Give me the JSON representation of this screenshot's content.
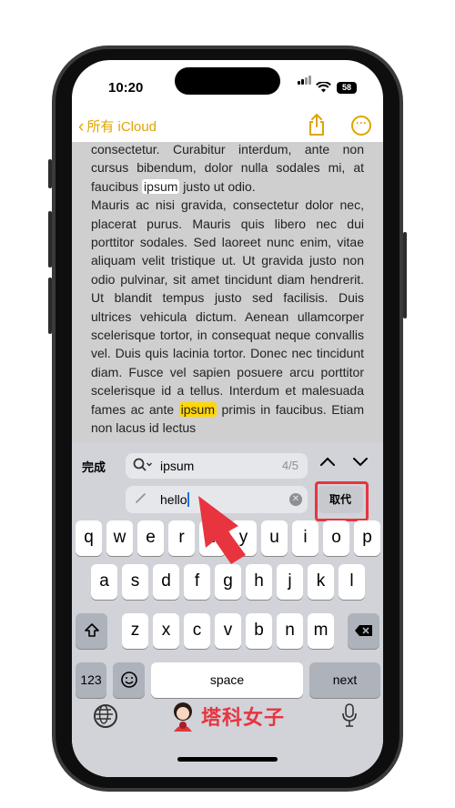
{
  "status_bar": {
    "time": "10:20",
    "battery": "58"
  },
  "nav": {
    "back_label": "所有 iCloud"
  },
  "note": {
    "t1": "consectetur. Curabitur interdum, ante non cursus bibendum, dolor nulla sodales mi, at faucibus ",
    "m1": "ipsum",
    "t2": " justo ut odio.",
    "t3": "Mauris ac nisi gravida, consectetur dolor nec, placerat purus. Mauris quis libero nec dui porttitor sodales. Sed laoreet nunc enim, vitae aliquam velit tristique ut. Ut gravida justo non odio pulvinar, sit amet tincidunt diam hendrerit. Ut blandit tempus justo sed facilisis. Duis ultrices vehicula dictum. Aenean ullamcorper scelerisque tortor, in consequat neque convallis vel. Duis quis lacinia tortor. Donec nec tincidunt diam. Fusce vel sapien posuere arcu porttitor scelerisque id a tellus. Interdum et malesuada fames ac ante ",
    "m2": "ipsum",
    "t4": " primis in faucibus. Etiam non lacus id lectus"
  },
  "find": {
    "done_label": "完成",
    "query": "ipsum",
    "count": "4/5"
  },
  "replace": {
    "value": "hello",
    "button_label": "取代"
  },
  "keyboard": {
    "row1": [
      "q",
      "w",
      "e",
      "r",
      "t",
      "y",
      "u",
      "i",
      "o",
      "p"
    ],
    "row2": [
      "a",
      "s",
      "d",
      "f",
      "g",
      "h",
      "j",
      "k",
      "l"
    ],
    "row3": [
      "z",
      "x",
      "c",
      "v",
      "b",
      "n",
      "m"
    ],
    "numbers_label": "123",
    "space_label": "space",
    "next_label": "next"
  },
  "watermark": {
    "text": "塔科女子"
  },
  "colors": {
    "accent": "#e0a400",
    "highlight_current": "#ffd60a",
    "annotation_red": "#e8343f"
  }
}
